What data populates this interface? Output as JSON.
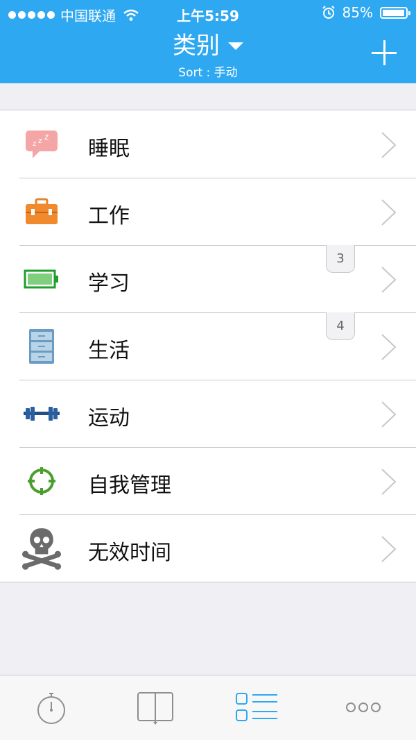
{
  "status_bar": {
    "carrier": "中国联通",
    "time": "上午5:59",
    "battery": "85%",
    "battery_level": 0.85
  },
  "header": {
    "title": "类别",
    "subtitle": "Sort : 手动"
  },
  "categories": [
    {
      "label": "睡眠",
      "icon": "sleep-zzz-icon",
      "badge": ""
    },
    {
      "label": "工作",
      "icon": "briefcase-icon",
      "badge": ""
    },
    {
      "label": "学习",
      "icon": "battery-icon",
      "badge": "3"
    },
    {
      "label": "生活",
      "icon": "cabinet-icon",
      "badge": "4"
    },
    {
      "label": "运动",
      "icon": "dumbbell-icon",
      "badge": ""
    },
    {
      "label": "自我管理",
      "icon": "target-icon",
      "badge": ""
    },
    {
      "label": "无效时间",
      "icon": "skull-crossbones-icon",
      "badge": ""
    }
  ],
  "tabbar": {
    "tabs": [
      {
        "icon": "stopwatch-icon"
      },
      {
        "icon": "book-icon"
      },
      {
        "icon": "list-icon"
      },
      {
        "icon": "more-icon"
      }
    ],
    "active_index": 2
  },
  "colors": {
    "header": "#2fa8f2",
    "accent": "#2fa8f2",
    "tab_inactive": "#8e8e93"
  }
}
